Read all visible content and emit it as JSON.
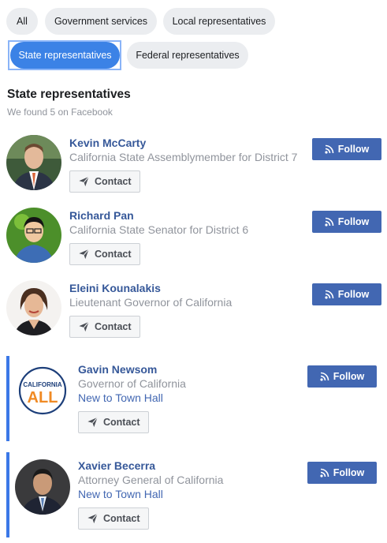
{
  "filters": {
    "chips": [
      {
        "label": "All",
        "active": false
      },
      {
        "label": "Government services",
        "active": false
      },
      {
        "label": "Local representatives",
        "active": false
      },
      {
        "label": "State representatives",
        "active": true
      },
      {
        "label": "Federal representatives",
        "active": false
      }
    ]
  },
  "section": {
    "title": "State representatives",
    "subtitle": "We found 5 on Facebook"
  },
  "representatives": [
    {
      "name": "Kevin McCarty",
      "title": "California State Assemblymember for District 7",
      "new_label": "",
      "contact_label": "Contact",
      "follow_label": "Follow"
    },
    {
      "name": "Richard Pan",
      "title": "California State Senator for District 6",
      "new_label": "",
      "contact_label": "Contact",
      "follow_label": "Follow"
    },
    {
      "name": "Eleini Kounalakis",
      "title": "Lieutenant Governor of California",
      "new_label": "",
      "contact_label": "Contact",
      "follow_label": "Follow"
    },
    {
      "name": "Gavin Newsom",
      "title": "Governor of California",
      "new_label": "New to Town Hall",
      "contact_label": "Contact",
      "follow_label": "Follow"
    },
    {
      "name": "Xavier Becerra",
      "title": "Attorney General of California",
      "new_label": "New to Town Hall",
      "contact_label": "Contact",
      "follow_label": "Follow"
    }
  ],
  "logo": {
    "line1": "CALIFORNIA",
    "line2": "ALL"
  },
  "colors": {
    "accent": "#3b82e6",
    "follow": "#4267b2",
    "name": "#365899",
    "highlight_bar": "#3b78e7"
  }
}
